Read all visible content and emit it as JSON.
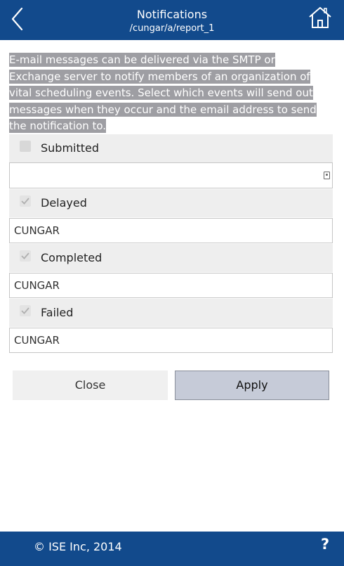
{
  "header": {
    "title": "Notifications",
    "subtitle": "/cungar/a/report_1",
    "back_icon": "chevron-left-icon",
    "home_icon": "home-icon",
    "background": "#124a8c"
  },
  "description": "E-mail messages can be delivered via the SMTP or Exchange server to notify members of an organization of vital scheduling events. Select which events will send out messages when they occur and the email address to send the notification to.",
  "events": [
    {
      "label": "Submitted",
      "checked": false,
      "email": ""
    },
    {
      "label": "Delayed",
      "checked": true,
      "email": "CUNGAR"
    },
    {
      "label": "Completed",
      "checked": true,
      "email": "CUNGAR"
    },
    {
      "label": "Failed",
      "checked": true,
      "email": "CUNGAR"
    }
  ],
  "buttons": {
    "close_label": "Close",
    "apply_label": "Apply"
  },
  "footer": {
    "copyright": "© ISE Inc, 2014",
    "help_label": "?"
  }
}
